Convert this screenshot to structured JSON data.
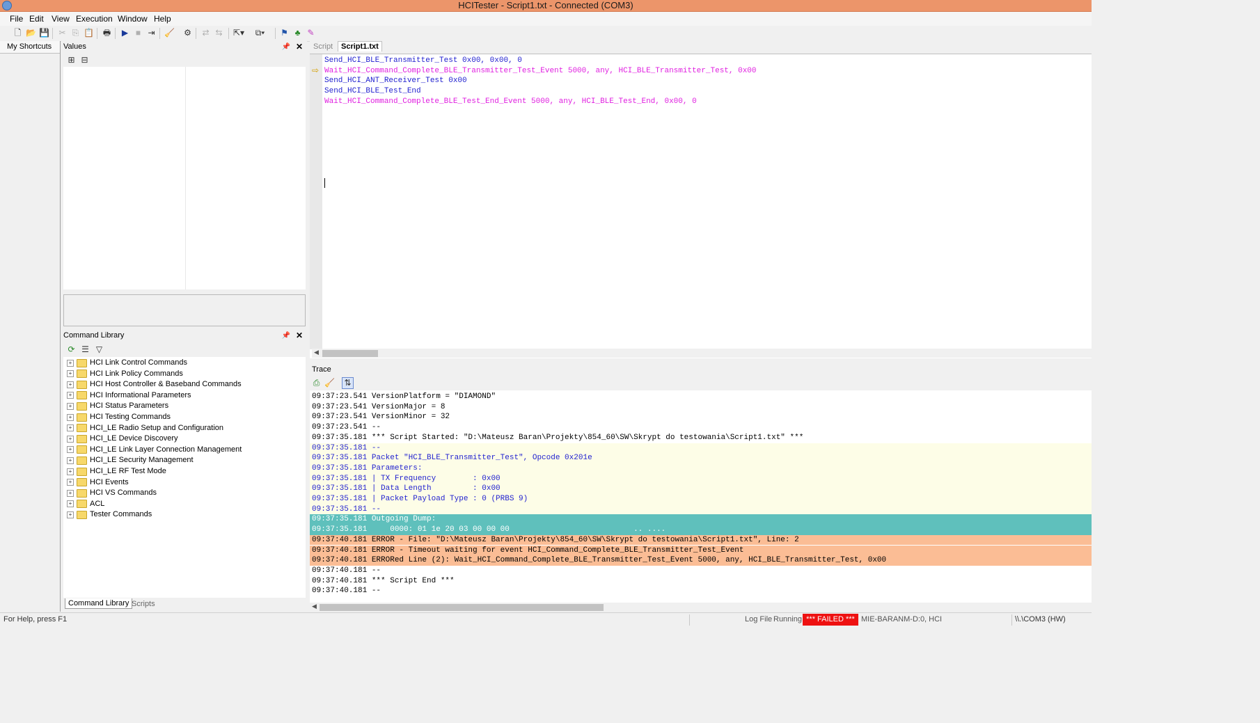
{
  "window": {
    "title": "HCITester - Script1.txt - Connected (COM3)"
  },
  "menu": [
    "File",
    "Edit",
    "View",
    "Execution",
    "Window",
    "Help"
  ],
  "shortcuts": {
    "label": "My Shortcuts"
  },
  "values_panel": {
    "title": "Values"
  },
  "command_library": {
    "title": "Command Library",
    "items": [
      "HCI Link Control Commands",
      "HCI Link Policy Commands",
      "HCI Host Controller & Baseband Commands",
      "HCI Informational Parameters",
      "HCI Status Parameters",
      "HCI Testing Commands",
      "HCI_LE Radio Setup and Configuration",
      "HCI_LE Device Discovery",
      "HCI_LE Link Layer Connection Management",
      "HCI_LE Security Management",
      "HCI_LE RF Test Mode",
      "HCI Events",
      "HCI VS Commands",
      "ACL",
      "Tester Commands"
    ],
    "tabs": [
      "Command Library",
      "Scripts"
    ]
  },
  "editor": {
    "tabs": [
      "Script",
      "Script1.txt"
    ],
    "lines": [
      {
        "text": "Send_HCI_BLE_Transmitter_Test 0x00, 0x00, 0",
        "color": "#1f1fcf"
      },
      {
        "text": "Wait_HCI_Command_Complete_BLE_Transmitter_Test_Event 5000, any, HCI_BLE_Transmitter_Test, 0x00",
        "color": "#e020e0"
      },
      {
        "text": "Send_HCI_ANT_Receiver_Test 0x00",
        "color": "#1f1fcf"
      },
      {
        "text": "Send_HCI_BLE_Test_End",
        "color": "#1f1fcf"
      },
      {
        "text": "Wait_HCI_Command_Complete_BLE_Test_End_Event 5000, any, HCI_BLE_Test_End, 0x00, 0",
        "color": "#e020e0"
      }
    ]
  },
  "trace": {
    "title": "Trace",
    "lines": [
      {
        "text": "09:37:23.541 VersionPlatform = \"DIAMOND\"",
        "bg": "#ffffff",
        "fg": "#000000"
      },
      {
        "text": "09:37:23.541 VersionMajor = 8",
        "bg": "#ffffff",
        "fg": "#000000"
      },
      {
        "text": "09:37:23.541 VersionMinor = 32",
        "bg": "#ffffff",
        "fg": "#000000"
      },
      {
        "text": "09:37:23.541 --",
        "bg": "#ffffff",
        "fg": "#000000"
      },
      {
        "text": "09:37:35.181 *** Script Started: \"D:\\Mateusz Baran\\Projekty\\854_60\\SW\\Skrypt do testowania\\Script1.txt\" ***",
        "bg": "#ffffff",
        "fg": "#000000"
      },
      {
        "text": "09:37:35.181 --",
        "bg": "#fdfde7",
        "fg": "#1f1fcf"
      },
      {
        "text": "09:37:35.181 Packet \"HCI_BLE_Transmitter_Test\", Opcode 0x201e",
        "bg": "#fdfde7",
        "fg": "#1f1fcf"
      },
      {
        "text": "09:37:35.181 Parameters:",
        "bg": "#fdfde7",
        "fg": "#1f1fcf"
      },
      {
        "text": "09:37:35.181 | TX Frequency        : 0x00",
        "bg": "#fdfde7",
        "fg": "#1f1fcf"
      },
      {
        "text": "09:37:35.181 | Data Length         : 0x00",
        "bg": "#fdfde7",
        "fg": "#1f1fcf"
      },
      {
        "text": "09:37:35.181 | Packet Payload Type : 0 (PRBS 9)",
        "bg": "#fdfde7",
        "fg": "#1f1fcf"
      },
      {
        "text": "09:37:35.181 --",
        "bg": "#fdfde7",
        "fg": "#1f1fcf"
      },
      {
        "text": "09:37:35.181 Outgoing Dump:",
        "bg": "#5fc0bc",
        "fg": "#ffffff"
      },
      {
        "text": "09:37:35.181     0000: 01 1e 20 03 00 00 00                           .. ....",
        "bg": "#5fc0bc",
        "fg": "#ffffff"
      },
      {
        "text": "09:37:40.181 ERROR - File: \"D:\\Mateusz Baran\\Projekty\\854_60\\SW\\Skrypt do testowania\\Script1.txt\", Line: 2",
        "bg": "#fbbd95",
        "fg": "#000000"
      },
      {
        "text": "09:37:40.181 ERROR - Timeout waiting for event HCI_Command_Complete_BLE_Transmitter_Test_Event",
        "bg": "#fbbd95",
        "fg": "#000000"
      },
      {
        "text": "09:37:40.181 ERRORed Line (2): Wait_HCI_Command_Complete_BLE_Transmitter_Test_Event 5000, any, HCI_BLE_Transmitter_Test, 0x00",
        "bg": "#fbbd95",
        "fg": "#000000"
      },
      {
        "text": "09:37:40.181 --",
        "bg": "#ffffff",
        "fg": "#000000"
      },
      {
        "text": "09:37:40.181 *** Script End ***",
        "bg": "#ffffff",
        "fg": "#000000"
      },
      {
        "text": "09:37:40.181 --",
        "bg": "#ffffff",
        "fg": "#000000"
      }
    ]
  },
  "status": {
    "help": "For Help, press F1",
    "log_file": "Log File",
    "running": "Running",
    "failed": "*** FAILED ***",
    "machine": "MIE-BARANM-D:0, HCI",
    "port": "\\\\.\\COM3 (HW)"
  }
}
